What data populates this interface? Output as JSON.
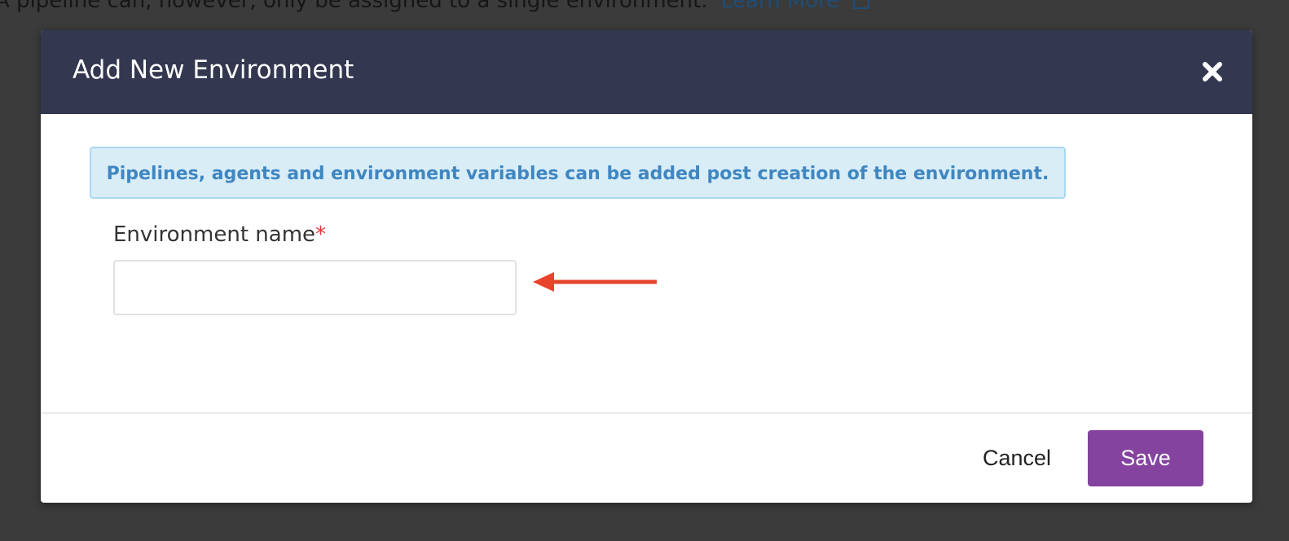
{
  "background": {
    "text": "A pipeline can, however, only be assigned to a single environment.",
    "link_text": "Learn More"
  },
  "modal": {
    "title": "Add New Environment",
    "close_icon": "close-icon",
    "info_message": "Pipelines, agents and environment variables can be added post creation of the environment.",
    "form": {
      "environment_name_label": "Environment name",
      "required_marker": "*",
      "environment_name_value": "",
      "environment_name_placeholder": ""
    },
    "footer": {
      "cancel_label": "Cancel",
      "save_label": "Save"
    }
  },
  "annotation": {
    "arrow_icon": "arrow-left-icon",
    "arrow_color": "#e8442c"
  },
  "colors": {
    "header_bg": "#333850",
    "info_bg": "#d9edf7",
    "info_text": "#3f86c1",
    "save_bg": "#8543a0",
    "required": "#e0373a"
  }
}
